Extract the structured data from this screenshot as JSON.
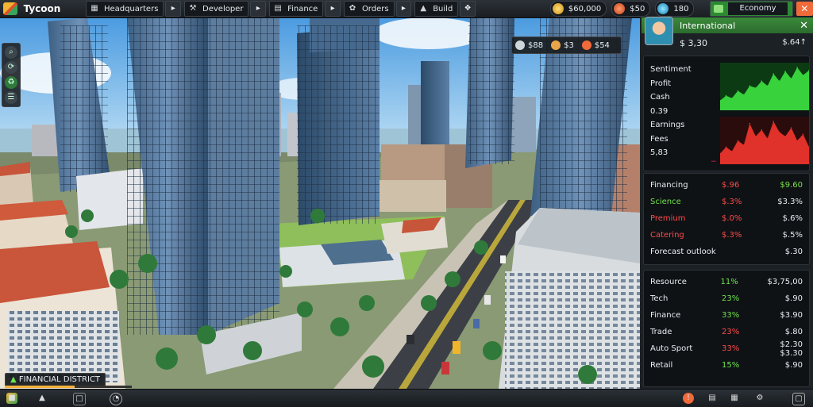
{
  "app": {
    "title": "Tycoon"
  },
  "toolbar": {
    "buttons": [
      {
        "label": "Headquarters",
        "icon": "company-icon"
      },
      {
        "label": "Developer",
        "icon": "tools-icon"
      },
      {
        "label": "Finance",
        "icon": "chart-icon"
      },
      {
        "label": "Orders",
        "icon": "handshake-icon"
      },
      {
        "label": "Build",
        "icon": "building-icon"
      }
    ]
  },
  "resources": {
    "money": "$60,000",
    "income": "$50",
    "population": "180",
    "status": "Economy"
  },
  "overlay": {
    "happiness": "$88",
    "workers": "$3",
    "buildings": "$54"
  },
  "district": {
    "label": "FINANCIAL DISTRICT",
    "progress": 0.55
  },
  "panel": {
    "title": "International",
    "value": "$ 3,30",
    "change": "$.64↑",
    "chart_labels": [
      "Sentiment",
      "Profit",
      "Cash",
      "0.39",
      "Earnings",
      "Fees",
      "5,83"
    ],
    "market_rows": [
      {
        "name": "Financing",
        "val": "$.96",
        "delta": "$9.60",
        "nc": "#e8eef2",
        "vc": "#ff4a4a",
        "dc": "#7be04a"
      },
      {
        "name": "Science",
        "val": "$.3%",
        "delta": "$3.3%",
        "nc": "#6ee24a",
        "vc": "#ff4a4a",
        "dc": "#e8eef2"
      },
      {
        "name": "Premium",
        "val": "$.0%",
        "delta": "$.6%",
        "nc": "#ff4a4a",
        "vc": "#ff4a4a",
        "dc": "#e8eef2"
      },
      {
        "name": "Catering",
        "val": "$.3%",
        "delta": "$.5%",
        "nc": "#ff4a4a",
        "vc": "#ff4a4a",
        "dc": "#e8eef2"
      },
      {
        "name": "Forecast outlook",
        "val": "",
        "delta": "$.30",
        "nc": "#e8eef2",
        "vc": "#e8eef2",
        "dc": "#e8eef2"
      }
    ],
    "stats_rows": [
      {
        "name": "Resource",
        "val": "11%",
        "amt": "$3,75,00",
        "vc": "#6ee24a"
      },
      {
        "name": "Tech",
        "val": "23%",
        "amt": "$.90",
        "vc": "#6ee24a"
      },
      {
        "name": "Finance",
        "val": "33%",
        "amt": "$3.90",
        "vc": "#6ee24a"
      },
      {
        "name": "Trade",
        "val": "23%",
        "amt": "$.80",
        "vc": "#ff4a4a"
      },
      {
        "name": "Auto Sport",
        "val": "33%",
        "amt": "$2.30 $3.30",
        "vc": "#ff4a4a"
      },
      {
        "name": "Retail",
        "val": "15%",
        "amt": "$.90",
        "vc": "#6ee24a"
      }
    ]
  },
  "colors": {
    "accent_green": "#2c8a32",
    "alert_orange": "#f06a3a",
    "gain": "#37d23c",
    "loss": "#e0312a"
  },
  "chart_data": [
    {
      "type": "area",
      "series": [
        {
          "values": [
            2,
            3,
            2.5,
            4,
            3.2,
            5,
            4.6,
            6,
            5,
            7.5,
            6,
            8,
            6.5,
            8.8,
            7.2,
            8.2
          ]
        }
      ]
    },
    {
      "type": "area",
      "series": [
        {
          "values": [
            1,
            1.6,
            1.2,
            2.2,
            1.8,
            3.8,
            2.6,
            3.2,
            2.4,
            4,
            3,
            2.6,
            3.4,
            2.2,
            2.8,
            1.6
          ]
        }
      ]
    }
  ]
}
